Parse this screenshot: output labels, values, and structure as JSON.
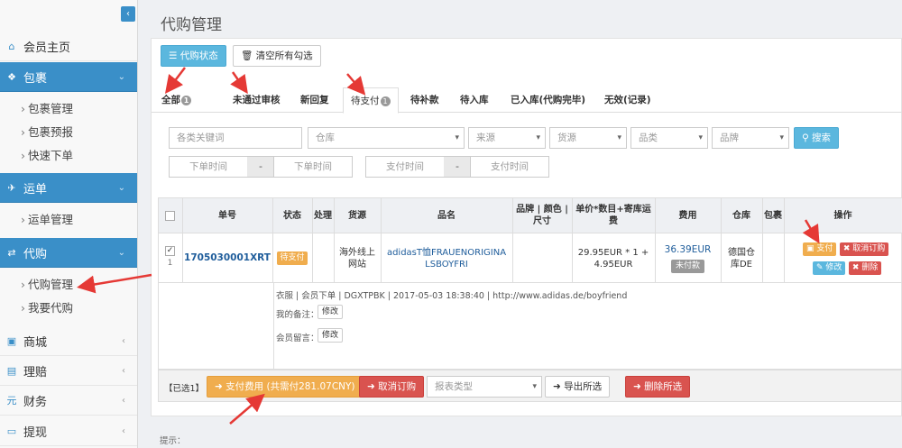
{
  "sidebar": {
    "home": "会员主页",
    "parcel": "包裹",
    "parcel_items": [
      "包裹管理",
      "包裹预报",
      "快速下单"
    ],
    "shipment": "运单",
    "shipment_items": [
      "运单管理"
    ],
    "proxy": "代购",
    "proxy_items": [
      "代购管理",
      "我要代购"
    ],
    "mall": "商城",
    "claims": "理赔",
    "finance": "财务",
    "withdraw": "提现"
  },
  "page": {
    "title": "代购管理",
    "btn_status": "代购状态",
    "btn_clear": "清空所有勾选"
  },
  "tabs": [
    {
      "label": "全部",
      "badge": "1"
    },
    {
      "label": "未通过审核",
      "badge": ""
    },
    {
      "label": "新回复",
      "badge": ""
    },
    {
      "label": "待支付",
      "badge": "1"
    },
    {
      "label": "待补款",
      "badge": ""
    },
    {
      "label": "待入库",
      "badge": ""
    },
    {
      "label": "已入库(代购完毕)",
      "badge": ""
    },
    {
      "label": "无效(记录)",
      "badge": ""
    }
  ],
  "filters": {
    "keyword_placeholder": "各类关键词",
    "warehouse": "仓库",
    "source": "来源",
    "supply": "货源",
    "category": "品类",
    "brand": "品牌",
    "search": "搜索",
    "order_time_from": "下单时间",
    "order_time_to": "下单时间",
    "pay_time_from": "支付时间",
    "pay_time_to": "支付时间",
    "dash": "-"
  },
  "table": {
    "headers": {
      "no": "单号",
      "status": "状态",
      "process": "处理",
      "supply": "货源",
      "name": "品名",
      "brand_color_size": "品牌 | 颜色 | 尺寸",
      "price": "单价*数目+寄库运费",
      "fee": "费用",
      "warehouse": "仓库",
      "pack": "包裹",
      "action": "操作"
    },
    "row": {
      "index": "1",
      "order_no": "1705030001XRT",
      "status": "待支付",
      "supply": "海外线上网站",
      "name": "adidasT恤FRAUENORIGINALSBOYFRI",
      "price": "29.95EUR * 1 + 4.95EUR",
      "fee": "36.39EUR",
      "fee_status": "未付款",
      "warehouse": "德国仓库DE",
      "act_pay": "支付",
      "act_cancel": "取消订购",
      "act_edit": "修改",
      "act_delete": "删除"
    },
    "detail": {
      "info": "衣服 | 会员下单 | DGXTPBK | 2017-05-03 18:38:40 | http://www.adidas.de/boyfriend",
      "my_note_label": "我的备注：",
      "member_msg_label": "会员留言：",
      "edit": "修改"
    }
  },
  "footer": {
    "selected": "【已选1】",
    "pay_fee": "支付费用 (共需付281.07CNY)",
    "cancel_order": "取消订购",
    "report_type": "报表类型",
    "export": "导出所选",
    "delete_selected": "删除所选"
  },
  "hint": "提示："
}
